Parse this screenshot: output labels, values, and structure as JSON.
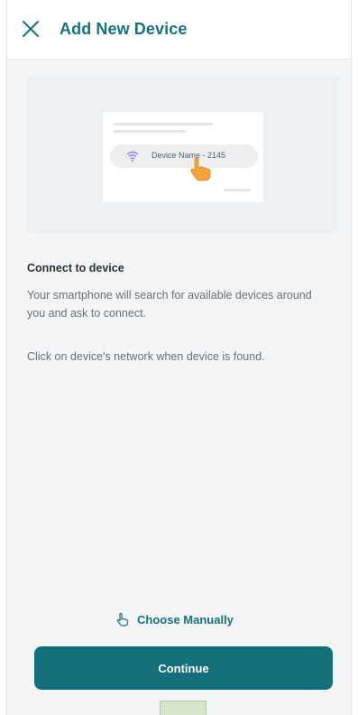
{
  "header": {
    "close_icon": "close-icon",
    "title": "Add New Device"
  },
  "illustration": {
    "device_name": "Device Name - 2145",
    "icons": [
      "wifi-icon",
      "hand-pointer-icon"
    ]
  },
  "content": {
    "section_title": "Connect to device",
    "description": "Your smartphone will search for available devices around you and ask to connect.",
    "hint": "Click on device's network when device is found."
  },
  "actions": {
    "manual_icon": "hand-icon",
    "manual_label": "Choose Manually",
    "continue_label": "Continue"
  },
  "colors": {
    "accent": "#17727c",
    "button": "#13707b",
    "background": "#f4f5f6",
    "hand": "#f2a33a",
    "wifi": "#9a7fe0"
  }
}
